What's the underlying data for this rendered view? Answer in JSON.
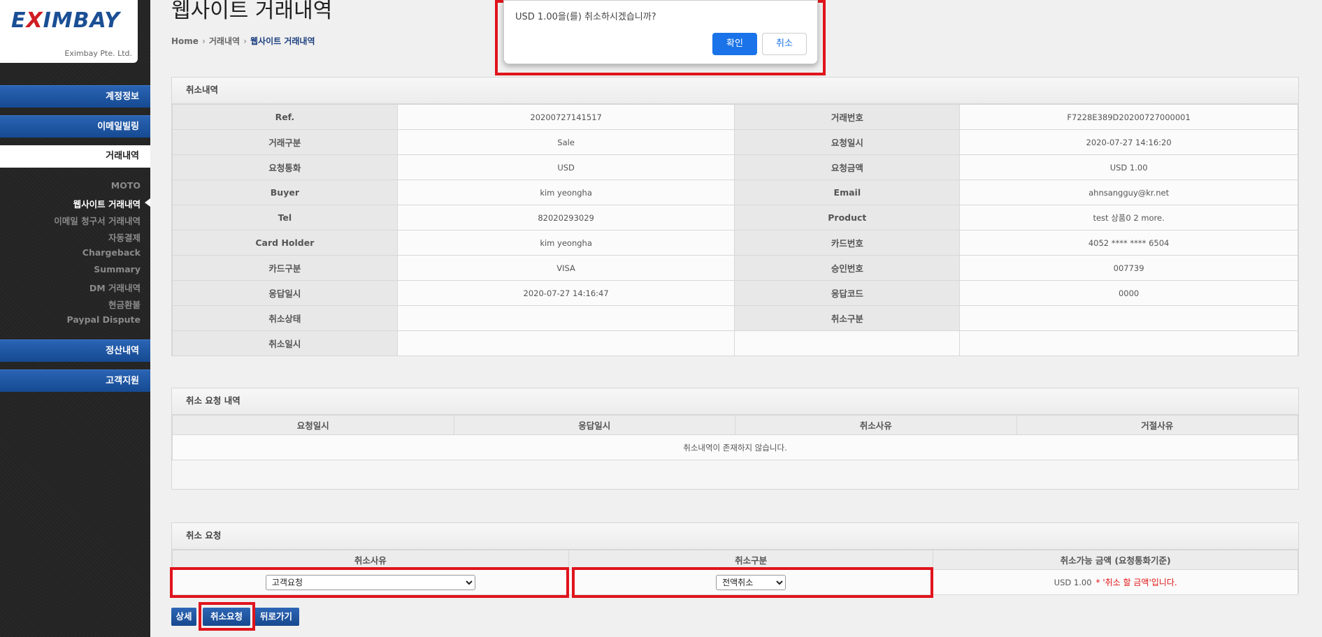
{
  "logo": {
    "brand_pre": "E",
    "brand_x": "X",
    "brand_post": "IMBAY",
    "company": "Eximbay Pte. Ltd."
  },
  "sidebar": {
    "main_items": [
      {
        "label": "계정정보"
      },
      {
        "label": "이메일빌링"
      },
      {
        "label": "거래내역"
      },
      {
        "label": "정산내역"
      },
      {
        "label": "고객지원"
      }
    ],
    "sub_items": [
      {
        "label": "MOTO"
      },
      {
        "label": "웹사이트 거래내역"
      },
      {
        "label": "이메일 청구서 거래내역"
      },
      {
        "label": "자동결제"
      },
      {
        "label": "Chargeback"
      },
      {
        "label": "Summary"
      },
      {
        "label": "DM 거래내역"
      },
      {
        "label": "현금환불"
      },
      {
        "label": "Paypal Dispute"
      }
    ]
  },
  "page": {
    "title": "웹사이트 거래내역",
    "breadcrumb": [
      "Home",
      "거래내역",
      "웹사이트 거래내역"
    ]
  },
  "cancel_details": {
    "heading": "취소내역",
    "rows": [
      [
        "Ref.",
        "20200727141517",
        "거래번호",
        "F7228E389D20200727000001"
      ],
      [
        "거래구분",
        "Sale",
        "요청일시",
        "2020-07-27 14:16:20"
      ],
      [
        "요청통화",
        "USD",
        "요청금액",
        "USD 1.00"
      ],
      [
        "Buyer",
        "kim yeongha",
        "Email",
        "ahnsangguy@kr.net"
      ],
      [
        "Tel",
        "82020293029",
        "Product",
        "test 상품0 2 more."
      ],
      [
        "Card Holder",
        "kim yeongha",
        "카드번호",
        "4052 **** **** 6504"
      ],
      [
        "카드구분",
        "VISA",
        "승인번호",
        "007739"
      ],
      [
        "응답일시",
        "2020-07-27 14:16:47",
        "응답코드",
        "0000"
      ],
      [
        "취소상태",
        "",
        "취소구분",
        ""
      ],
      [
        "취소일시",
        "",
        "",
        ""
      ]
    ]
  },
  "cancel_request_history": {
    "heading": "취소 요청 내역",
    "columns": [
      "요청일시",
      "응답일시",
      "취소사유",
      "거절사유"
    ],
    "empty_message": "취소내역이 존재하지 않습니다."
  },
  "cancel_request": {
    "heading": "취소 요청",
    "columns": [
      "취소사유",
      "취소구분",
      "취소가능 금액 (요청통화기준)"
    ],
    "reason_selected": "고객요청",
    "type_selected": "전액취소",
    "amount": "USD 1.00",
    "note": "* '취소 할 금액'입니다."
  },
  "buttons": {
    "detail": "상세",
    "cancel_request": "취소요청",
    "back": "뒤로가기"
  },
  "dialog": {
    "message": "USD 1.00을(를) 취소하시겠습니까?",
    "ok": "확인",
    "cancel": "취소"
  },
  "colors": {
    "accent_blue": "#1b4f95",
    "highlight_red": "#e0141c",
    "dialog_blue": "#1a73e8"
  }
}
